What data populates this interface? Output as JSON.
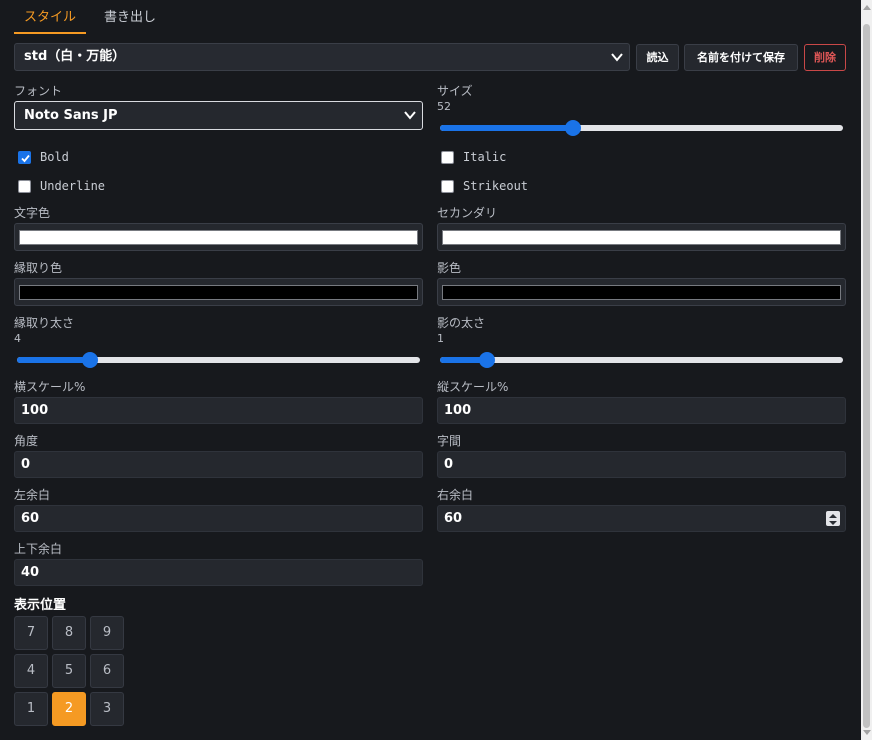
{
  "tabs": [
    {
      "label": "スタイル",
      "active": true
    },
    {
      "label": "書き出し",
      "active": false
    }
  ],
  "style_select": {
    "value": "std（白・万能）"
  },
  "buttons": {
    "load": "読込",
    "save_as": "名前を付けて保存",
    "delete": "削除"
  },
  "font": {
    "label": "フォント",
    "value": "Noto Sans JP"
  },
  "size": {
    "label": "サイズ",
    "value": "52",
    "level": 0.33
  },
  "checkboxes": [
    {
      "label": "Bold",
      "checked": true
    },
    {
      "label": "Italic",
      "checked": false
    },
    {
      "label": "Underline",
      "checked": false
    },
    {
      "label": "Strikeout",
      "checked": false
    }
  ],
  "colors": {
    "text": {
      "label": "文字色",
      "value": "#ffffff"
    },
    "secondary": {
      "label": "セカンダリ",
      "value": "#ffffff"
    },
    "outline": {
      "label": "縁取り色",
      "value": "#000000"
    },
    "shadow": {
      "label": "影色",
      "value": "#000000"
    }
  },
  "outline_width": {
    "label": "縁取り太さ",
    "value": "4",
    "level": 0.18
  },
  "shadow_width": {
    "label": "影の太さ",
    "value": "1",
    "level": 0.117
  },
  "scale_x": {
    "label": "横スケール%",
    "value": "100"
  },
  "scale_y": {
    "label": "縦スケール%",
    "value": "100"
  },
  "angle": {
    "label": "角度",
    "value": "0"
  },
  "spacing": {
    "label": "字間",
    "value": "0"
  },
  "margin_left": {
    "label": "左余白",
    "value": "60"
  },
  "margin_right": {
    "label": "右余白",
    "value": "60"
  },
  "margin_vertical": {
    "label": "上下余白",
    "value": "40"
  },
  "position": {
    "label": "表示位置",
    "grid": [
      "7",
      "8",
      "9",
      "4",
      "5",
      "6",
      "1",
      "2",
      "3"
    ],
    "selected": "2"
  },
  "accent_color": "#f59a23",
  "slider_color": "#1a73e8"
}
